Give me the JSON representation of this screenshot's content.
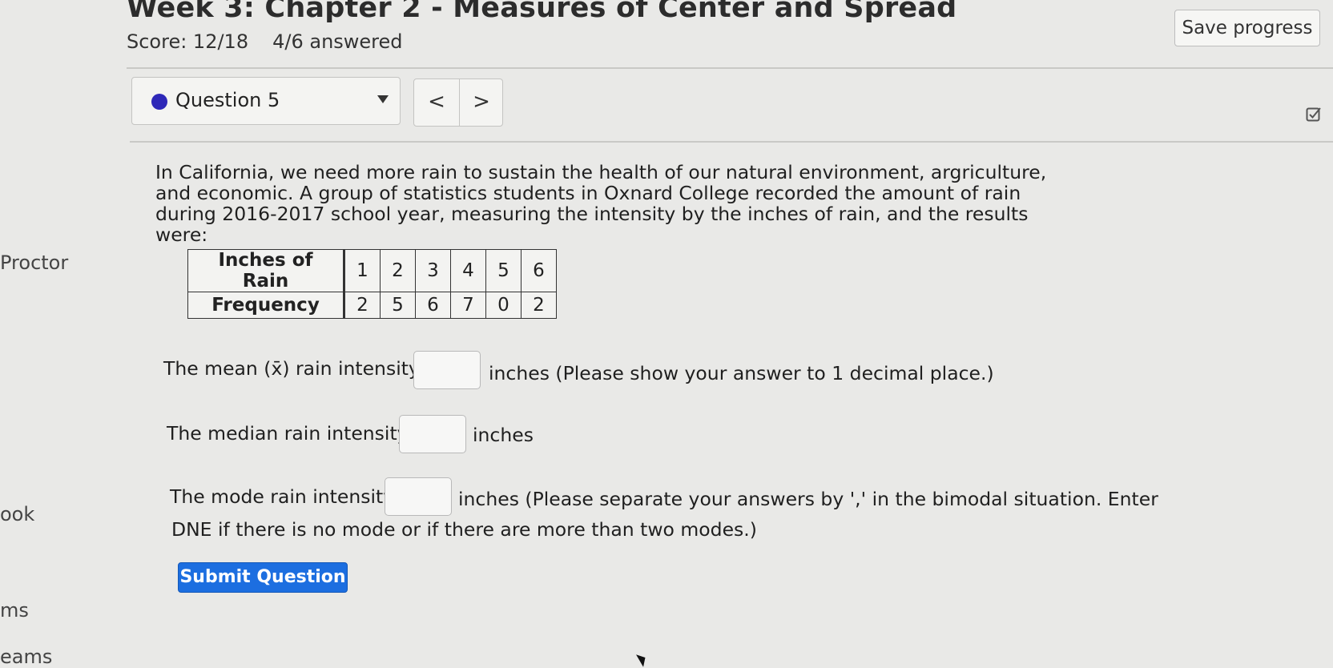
{
  "header": {
    "title": "Week 3: Chapter 2 - Measures of Center and Spread",
    "score": "Score: 12/18",
    "answered": "4/6 answered",
    "save_label": "Save progress"
  },
  "sidebar": {
    "items": [
      "Proctor",
      "ook",
      "ms",
      "eams"
    ]
  },
  "question_nav": {
    "selected": "Question 5",
    "prev_glyph": "<",
    "next_glyph": ">",
    "status_color": "#2e28b8"
  },
  "question": {
    "text": "In California, we need more rain to sustain the health of our natural environment, argriculture, and economic. A group of statistics students in Oxnard College recorded the amount of rain during 2016-2017 school year, measuring the intensity by the inches of rain, and the results were:",
    "table": {
      "row_headers": [
        "Inches of Rain",
        "Frequency"
      ],
      "inches": [
        "1",
        "2",
        "3",
        "4",
        "5",
        "6"
      ],
      "frequency": [
        "2",
        "5",
        "6",
        "7",
        "0",
        "2"
      ]
    },
    "mean_label": "The mean (x̄) rain intensity:",
    "mean_suffix": "inches (Please show your answer to 1 decimal place.)",
    "median_label": "The median rain intensity:",
    "median_suffix": "inches",
    "mode_label": "The mode rain intensity:",
    "mode_suffix": "inches (Please separate your answers by ',' in the bimodal situation. Enter",
    "mode_suffix_2": "DNE if there is no mode or if there are more than two modes.)",
    "submit_label": "Submit Question"
  },
  "colors": {
    "accent": "#1c6ee0",
    "background": "#e9e9e7"
  }
}
